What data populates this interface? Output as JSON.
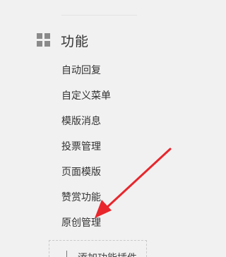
{
  "section": {
    "title": "功能",
    "icon": "grid-icon"
  },
  "menu": {
    "items": [
      {
        "label": "自动回复"
      },
      {
        "label": "自定义菜单"
      },
      {
        "label": "模版消息"
      },
      {
        "label": "投票管理"
      },
      {
        "label": "页面模版"
      },
      {
        "label": "赞赏功能"
      },
      {
        "label": "原创管理"
      }
    ]
  },
  "add_plugin": {
    "label": "添加功能插件",
    "icon": "plus-icon"
  },
  "colors": {
    "background": "#f1f1f1",
    "text": "#333333",
    "arrow": "#e8262c"
  }
}
